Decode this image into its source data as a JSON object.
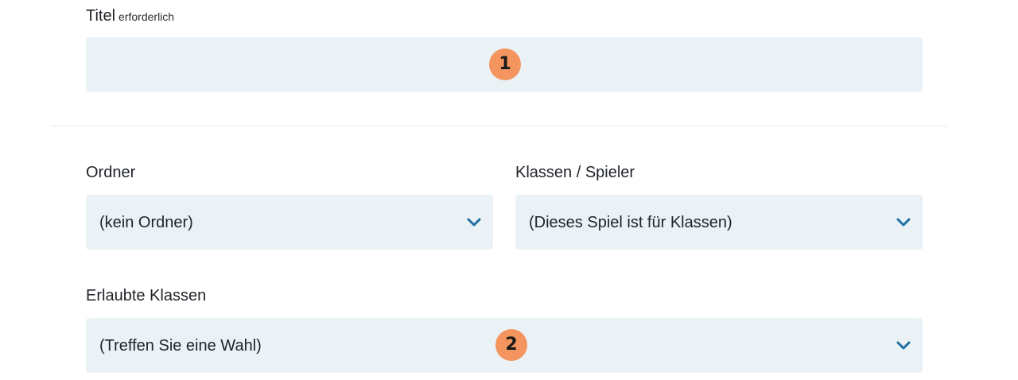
{
  "title_field": {
    "label": "Titel",
    "required_hint": "erforderlich",
    "value": ""
  },
  "folder_field": {
    "label": "Ordner",
    "selected": "(kein Ordner)",
    "icon": "chevron-down-icon"
  },
  "classes_players_field": {
    "label": "Klassen / Spieler",
    "selected": "(Dieses Spiel ist für Klassen)",
    "icon": "chevron-down-icon"
  },
  "allowed_classes_field": {
    "label": "Erlaubte Klassen",
    "selected": "(Treffen Sie eine Wahl)",
    "icon": "chevron-down-icon"
  },
  "markers": [
    "1",
    "2"
  ],
  "colors": {
    "field_background": "#eaf2f6",
    "chevron": "#1f6fa3",
    "marker": "#f4945f",
    "divider": "#ececec"
  }
}
